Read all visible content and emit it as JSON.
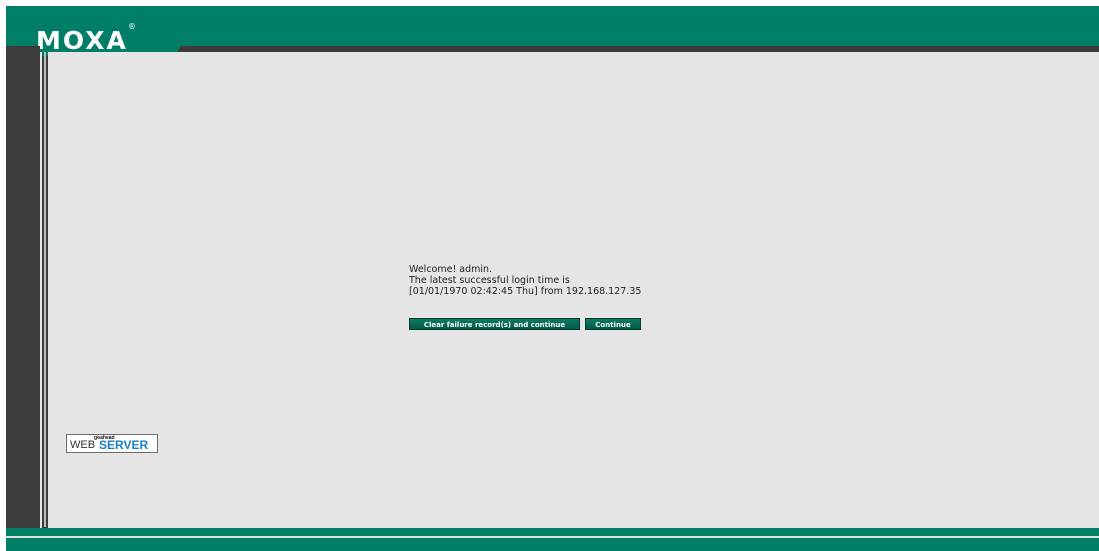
{
  "header": {
    "logo_text": "MOXA",
    "logo_mark": "®"
  },
  "login": {
    "welcome": "Welcome! admin.",
    "latest_label": "The latest successful login time is",
    "last_login": "[01/01/1970 02:42:45 Thu] from 192.168.127.35"
  },
  "buttons": {
    "clear_label": "Clear failure record(s) and continue",
    "continue_label": "Continue"
  },
  "badge": {
    "top": "goahead",
    "left": "WEB",
    "right": "SERVER"
  },
  "colors": {
    "brand": "#007f66",
    "content_bg": "#e5e5e5",
    "rail": "#3c3c3c",
    "badge_blue": "#1a7fc4"
  }
}
